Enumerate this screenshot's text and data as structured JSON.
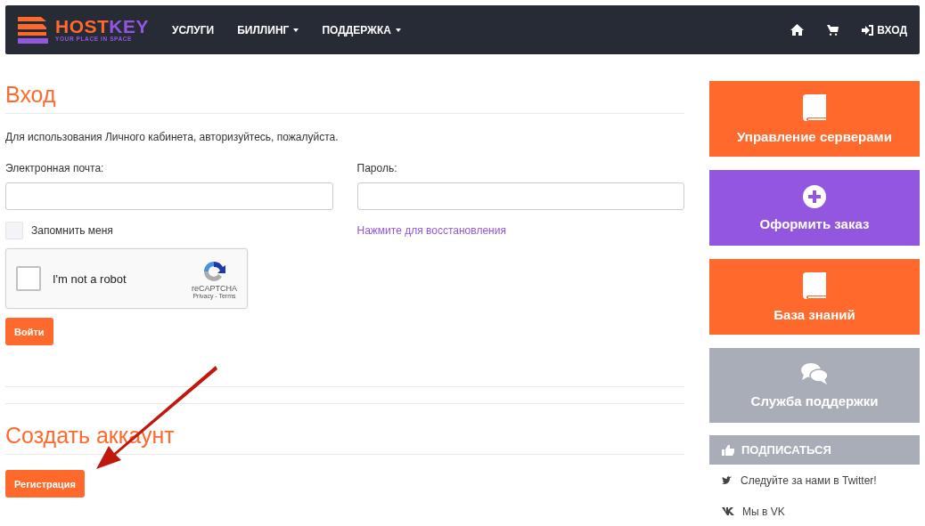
{
  "navbar": {
    "logo": {
      "name": "HOST",
      "name_accent": "KEY",
      "tagline": "YOUR PLACE IN SPACE"
    },
    "menu": [
      {
        "label": "УСЛУГИ",
        "dropdown": false
      },
      {
        "label": "БИЛЛИНГ",
        "dropdown": true
      },
      {
        "label": "ПОДДЕРЖКА",
        "dropdown": true
      }
    ],
    "login_link": "ВХОД"
  },
  "login": {
    "title": "Вход",
    "intro": "Для использования Личного кабинета, авторизуйтесь, пожалуйста.",
    "email_label": "Электронная почта:",
    "password_label": "Пароль:",
    "remember": {
      "label": "Запомнить меня",
      "checked": false
    },
    "forgot_link": "Нажмите для восстановления",
    "captcha": {
      "label": "I'm not a robot",
      "checked": false,
      "brand": "reCAPTCHA",
      "links": "Privacy - Terms"
    },
    "submit": "Войти"
  },
  "register": {
    "title": "Создать аккаунт",
    "button": "Регистрация"
  },
  "sidebar": {
    "tiles": [
      {
        "label": "Управление серверами",
        "color": "#ff6a2c"
      },
      {
        "label": "Оформить заказ",
        "color": "#9357df"
      },
      {
        "label": "База знаний",
        "color": "#ff6a2c"
      },
      {
        "label": "Служба поддержки",
        "color": "#a9adb8"
      }
    ],
    "subscribe": {
      "title": "ПОДПИСАТЬСЯ",
      "links": [
        {
          "label": "Следуйте за нами в Twitter!"
        },
        {
          "label": "Мы в VK"
        }
      ]
    }
  }
}
